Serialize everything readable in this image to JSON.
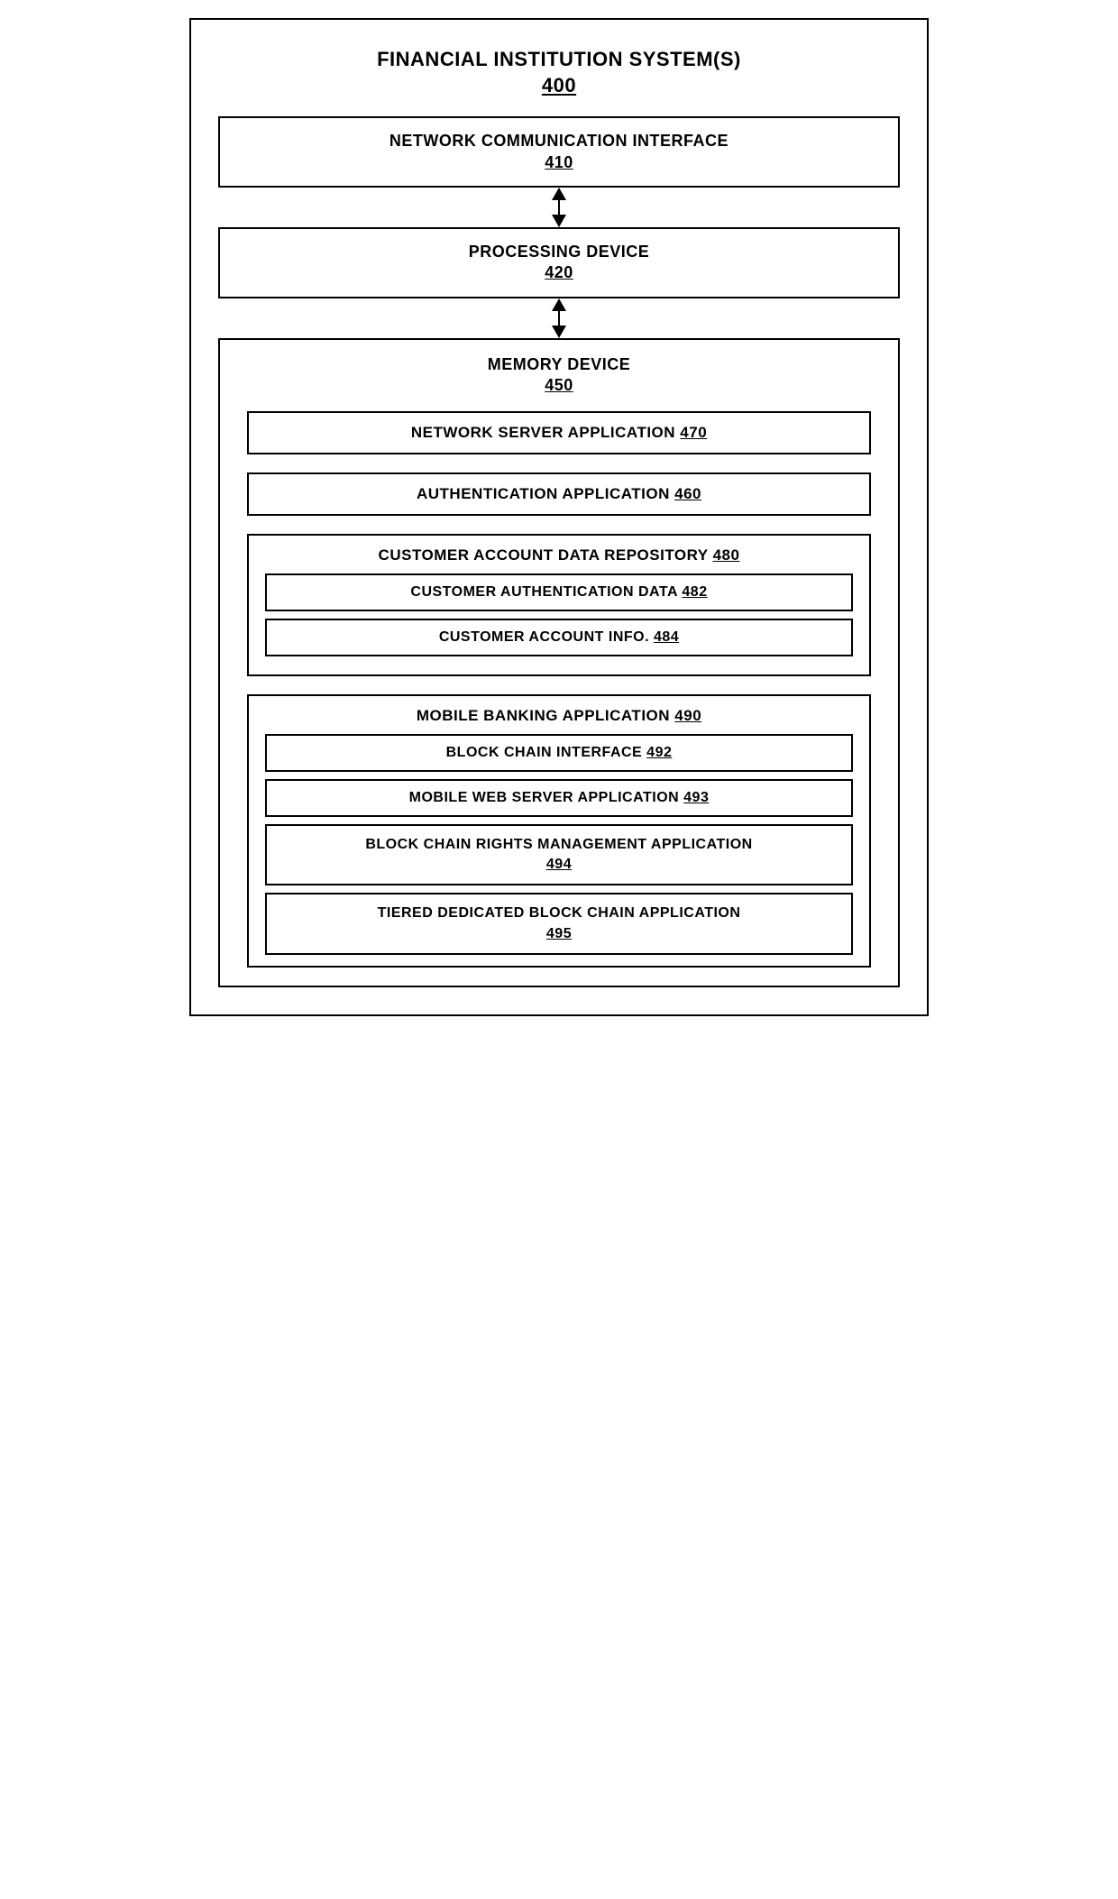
{
  "diagram": {
    "outer_title": "FINANCIAL INSTITUTION SYSTEM(S)",
    "outer_ref": "400",
    "network_comm": {
      "label": "NETWORK COMMUNICATION INTERFACE",
      "ref": "410"
    },
    "processing": {
      "label": "PROCESSING DEVICE",
      "ref": "420"
    },
    "memory": {
      "label": "MEMORY DEVICE",
      "ref": "450",
      "network_server": {
        "label": "NETWORK SERVER APPLICATION",
        "ref": "470"
      },
      "authentication": {
        "label": "AUTHENTICATION APPLICATION",
        "ref": "460"
      },
      "customer_repo": {
        "label": "CUSTOMER ACCOUNT DATA REPOSITORY",
        "ref": "480",
        "auth_data": {
          "label": "CUSTOMER AUTHENTICATION DATA",
          "ref": "482"
        },
        "account_info": {
          "label": "CUSTOMER ACCOUNT INFO.",
          "ref": "484"
        }
      },
      "mobile_banking": {
        "label": "MOBILE BANKING APPLICATION",
        "ref": "490",
        "blockchain_interface": {
          "label": "BLOCK CHAIN INTERFACE",
          "ref": "492"
        },
        "mobile_web_server": {
          "label": "MOBILE WEB SERVER APPLICATION",
          "ref": "493"
        },
        "blockchain_rights": {
          "label": "BLOCK CHAIN RIGHTS MANAGEMENT APPLICATION",
          "ref": "494"
        },
        "tiered_blockchain": {
          "label": "TIERED DEDICATED BLOCK CHAIN APPLICATION",
          "ref": "495"
        }
      }
    }
  }
}
